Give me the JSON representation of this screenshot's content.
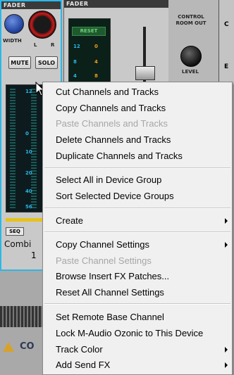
{
  "left_strip": {
    "header": "FADER",
    "width_label": "WIDTH",
    "l_label": "L",
    "r_label": "R",
    "mute_label": "MUTE",
    "solo_label": "SOLO",
    "scale": [
      "12",
      "0",
      "10",
      "20",
      "40",
      "56"
    ],
    "seq_label": "SEQ",
    "combi_label": "Combi",
    "number": "1"
  },
  "mid_strip": {
    "header": "FADER",
    "reset_label": "RESET",
    "scale_left": [
      "12",
      "8",
      "4"
    ],
    "scale_right": [
      "0",
      "4",
      "8"
    ],
    "crout_label": "CONTROL ROOM OUT",
    "level_label": "LEVEL"
  },
  "right_panel": {
    "c": "C",
    "e": "E"
  },
  "bottom": {
    "logo_text": "CO"
  },
  "menu": {
    "items": [
      {
        "label": "Cut Channels and Tracks",
        "disabled": false
      },
      {
        "label": "Copy Channels and Tracks",
        "disabled": false
      },
      {
        "label": "Paste Channels and Tracks",
        "disabled": true
      },
      {
        "label": "Delete Channels and Tracks",
        "disabled": false
      },
      {
        "label": "Duplicate Channels and Tracks",
        "disabled": false
      },
      {
        "label": "Select All in Device Group",
        "disabled": false
      },
      {
        "label": "Sort Selected Device Groups",
        "disabled": false
      },
      {
        "label": "Create",
        "disabled": false,
        "submenu": true
      },
      {
        "label": "Copy Channel Settings",
        "disabled": false,
        "submenu": true
      },
      {
        "label": "Paste Channel Settings",
        "disabled": true
      },
      {
        "label": "Browse Insert FX Patches...",
        "disabled": false
      },
      {
        "label": "Reset All Channel Settings",
        "disabled": false
      },
      {
        "label": "Set Remote Base Channel",
        "disabled": false
      },
      {
        "label": "Lock M-Audio Ozonic to This Device",
        "disabled": false
      },
      {
        "label": "Track Color",
        "disabled": false,
        "submenu": true
      },
      {
        "label": "Add Send FX",
        "disabled": false,
        "submenu": true
      }
    ]
  }
}
